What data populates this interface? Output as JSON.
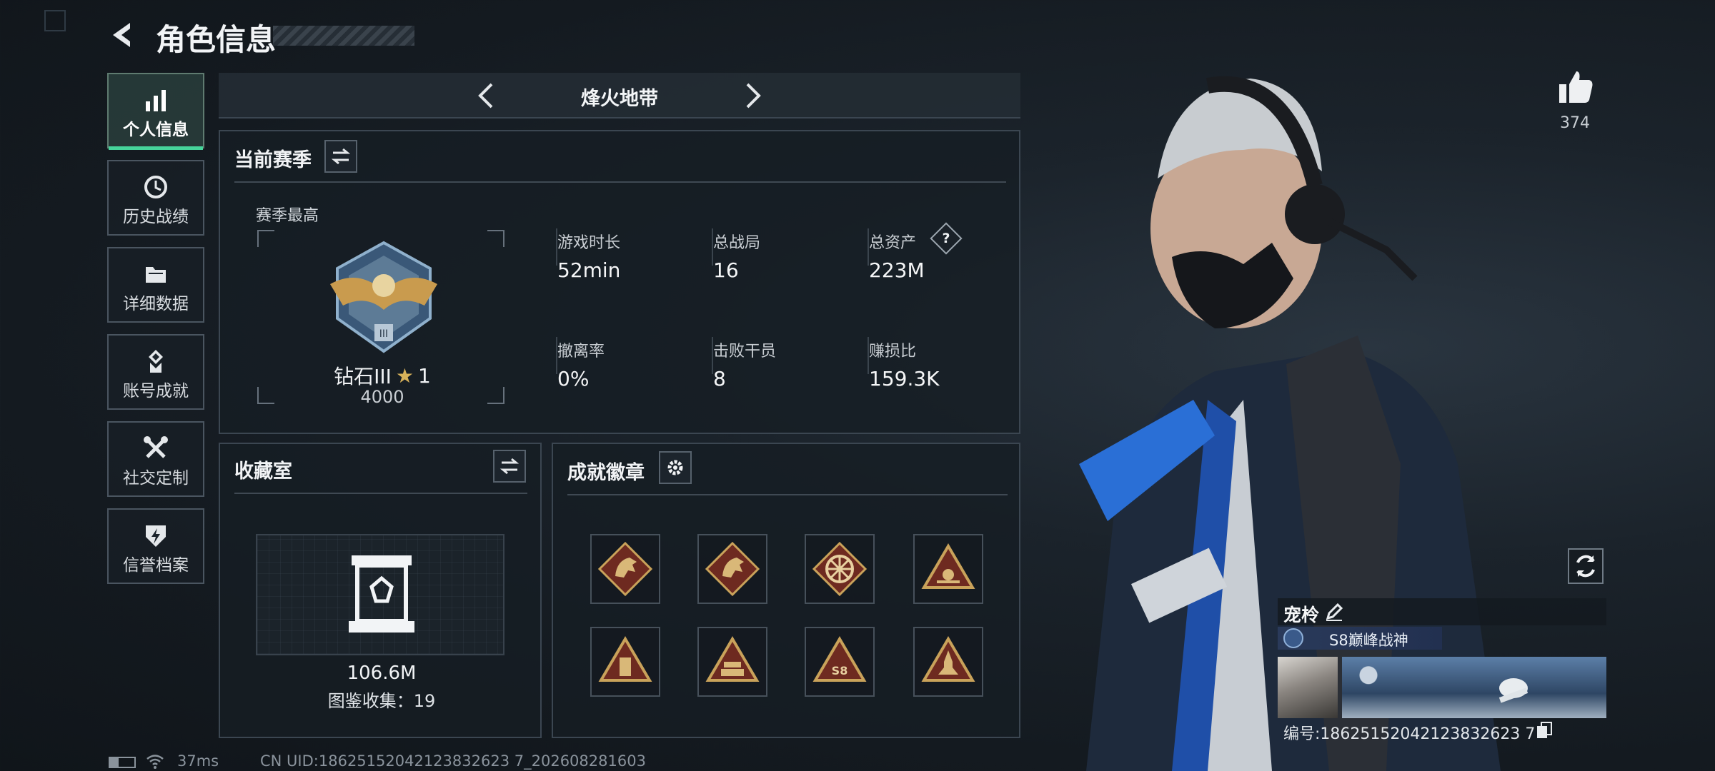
{
  "header": {
    "title": "角色信息"
  },
  "sidebar": {
    "items": [
      {
        "label": "个人信息",
        "icon": "bar-chart-icon",
        "active": true
      },
      {
        "label": "历史战绩",
        "icon": "clock-history-icon",
        "active": false
      },
      {
        "label": "详细数据",
        "icon": "folder-icon",
        "active": false
      },
      {
        "label": "账号成就",
        "icon": "achievement-icon",
        "active": false
      },
      {
        "label": "社交定制",
        "icon": "tools-icon",
        "active": false
      },
      {
        "label": "信誉档案",
        "icon": "credit-icon",
        "active": false
      }
    ]
  },
  "mode_selector": {
    "label": "烽火地带"
  },
  "season": {
    "title": "当前赛季",
    "best_label": "赛季最高",
    "rank_name": "钻石III",
    "rank_stars": "1",
    "rank_points": "4000",
    "stats": [
      {
        "label": "游戏时长",
        "value": "52min"
      },
      {
        "label": "总战局",
        "value": "16"
      },
      {
        "label": "总资产",
        "value": "223M",
        "has_help": true
      },
      {
        "label": "撤离率",
        "value": "0%"
      },
      {
        "label": "击败干员",
        "value": "8"
      },
      {
        "label": "赚损比",
        "value": "159.3K"
      }
    ],
    "help_glyph": "?"
  },
  "collection": {
    "title": "收藏室",
    "value": "106.6M",
    "catalog_label": "图鉴收集：",
    "catalog_count": "19"
  },
  "achievements": {
    "title": "成就徽章",
    "badges": [
      "horse-badge-icon",
      "horse-badge-icon",
      "wheel-badge-icon",
      "pyramid-badge-icon",
      "tower-badge-icon",
      "stack-badge-icon",
      "s8-badge-icon",
      "rocket-badge-icon"
    ],
    "s8_text": "S8"
  },
  "likes": {
    "count": "374"
  },
  "player_card": {
    "name": "宠柃",
    "title": "S8巅峰战神",
    "id_label": "编号:",
    "id_value": "18625152042123832623 7"
  },
  "status_bar": {
    "ping": "37ms",
    "uid": "CN UID:18625152042123832623 7_202608281603"
  },
  "colors": {
    "accent": "#46d49a",
    "panel_border": "#3b4651",
    "badge_gold": "#c9a25a",
    "badge_red": "#6e2a20",
    "title_bar": "#2a3a5a"
  }
}
